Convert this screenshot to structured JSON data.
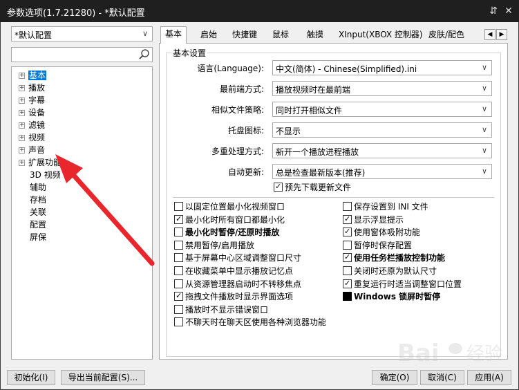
{
  "window": {
    "title": "参数选项(1.7.21280) - *默认配置",
    "pin_icon": "pin-icon",
    "close_icon": "close-icon"
  },
  "profile_combo": {
    "value": "*默认配置"
  },
  "search": {
    "placeholder": "",
    "icon": "search-icon"
  },
  "tree": {
    "items": [
      {
        "label": "基本",
        "expandable": true,
        "selected": true
      },
      {
        "label": "播放",
        "expandable": true
      },
      {
        "label": "字幕",
        "expandable": true
      },
      {
        "label": "设备",
        "expandable": true
      },
      {
        "label": "滤镜",
        "expandable": true
      },
      {
        "label": "视频",
        "expandable": true
      },
      {
        "label": "声音",
        "expandable": true
      },
      {
        "label": "扩展功能",
        "expandable": true
      },
      {
        "label": "3D 视频",
        "expandable": false
      },
      {
        "label": "辅助",
        "expandable": false
      },
      {
        "label": "存档",
        "expandable": false
      },
      {
        "label": "关联",
        "expandable": false
      },
      {
        "label": "配置",
        "expandable": false
      },
      {
        "label": "屏保",
        "expandable": false
      }
    ]
  },
  "tabs": [
    "基本",
    "启始",
    "快捷键",
    "鼠标",
    "触摸",
    "XInput(XBOX 控制器)",
    "皮肤/配色"
  ],
  "tab_scroll": {
    "left": "◀",
    "right": "▶"
  },
  "group_title": "基本设置",
  "fields": [
    {
      "label": "语言(Language):",
      "value": "中文(简体) - Chinese(Simplified).ini"
    },
    {
      "label": "最前端方式:",
      "value": "播放视频时在最前端"
    },
    {
      "label": "相似文件策略:",
      "value": "同时打开相似文件"
    },
    {
      "label": "托盘图标:",
      "value": "不显示"
    },
    {
      "label": "多重处理方式:",
      "value": "新开一个播放进程播放"
    },
    {
      "label": "自动更新:",
      "value": "总是检查最新版本(推荐)"
    }
  ],
  "predownload": {
    "label": "预先下载更新文件",
    "checked": true
  },
  "left_options": [
    {
      "label": "以固定位置最小化视频窗口",
      "state": "unchecked"
    },
    {
      "label": "最小化时所有窗口都最小化",
      "state": "checked"
    },
    {
      "label": "最小化时暂停/还原时播放",
      "state": "unchecked",
      "bold": true
    },
    {
      "label": "禁用暂停/启用播放",
      "state": "unchecked"
    },
    {
      "label": "基于屏幕中心区域调整窗口尺寸",
      "state": "unchecked"
    },
    {
      "label": "在收藏菜单中显示播放记忆点",
      "state": "unchecked"
    },
    {
      "label": "从资源管理器启动时不转移焦点",
      "state": "unchecked"
    },
    {
      "label": "拖拽文件播放时显示界面选项",
      "state": "checked"
    },
    {
      "label": "播放时不显示错误窗口",
      "state": "unchecked"
    },
    {
      "label": "不聊天时在聊天区使用各种浏览器功能",
      "state": "unchecked"
    }
  ],
  "right_options": [
    {
      "label": "保存设置到 INI 文件",
      "state": "unchecked"
    },
    {
      "label": "显示浮显提示",
      "state": "checked"
    },
    {
      "label": "使用窗体吸附功能",
      "state": "checked"
    },
    {
      "label": "暂停时保存配置",
      "state": "unchecked"
    },
    {
      "label": "使用任务栏播放控制功能",
      "state": "checked",
      "bold": true
    },
    {
      "label": "关闭时还原为默认尺寸",
      "state": "unchecked"
    },
    {
      "label": "重复运行时适当调整窗口位置",
      "state": "checked"
    },
    {
      "label": "Windows 锁屏时暂停",
      "state": "indeterminate",
      "bold": true
    }
  ],
  "buttons": {
    "init": "初始化(I)",
    "export": "导出当前配置(S)...",
    "ok": "确定(O)",
    "cancel": "取消(C)",
    "apply": "应用(A)"
  },
  "colors": {
    "titlebar": "#1f1f1f",
    "selection": "#0078d7",
    "annotation_arrow": "#e8262b"
  }
}
